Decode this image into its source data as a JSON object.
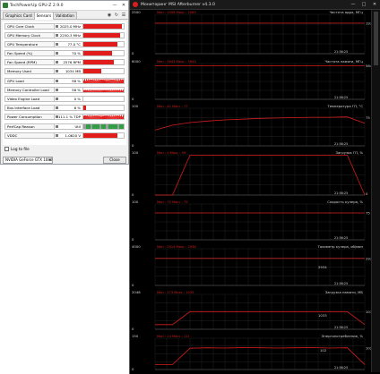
{
  "gpuz": {
    "title": "TechPowerUp GPU-Z 2.9.0",
    "tabs": [
      "Graphics Card",
      "Sensors",
      "Validation"
    ],
    "active_tab": 1,
    "sensors": [
      {
        "name": "GPU Core Clock",
        "value": "2025.0 MHz",
        "fill": 0.95,
        "kind": "bar"
      },
      {
        "name": "GPU Memory Clock",
        "value": "2250.3 MHz",
        "fill": 0.9,
        "kind": "bar"
      },
      {
        "name": "GPU Temperature",
        "value": "77.0 °C",
        "fill": 0.85,
        "kind": "bar"
      },
      {
        "name": "Fan Speed (%)",
        "value": "70 %",
        "fill": 0.7,
        "kind": "bar"
      },
      {
        "name": "Fan Speed (RPM)",
        "value": "2576 RPM",
        "fill": 0.75,
        "kind": "bar"
      },
      {
        "name": "Memory Used",
        "value": "1034 MB",
        "fill": 0.45,
        "kind": "bar"
      },
      {
        "name": "GPU Load",
        "value": "98 %",
        "fill": 0.95,
        "kind": "noisy"
      },
      {
        "name": "Memory Controller Load",
        "value": "56 %",
        "fill": 0.55,
        "kind": "noisy"
      },
      {
        "name": "Video Engine Load",
        "value": "0 %",
        "fill": 0.0,
        "kind": "bar"
      },
      {
        "name": "Bus Interface Load",
        "value": "6 %",
        "fill": 0.06,
        "kind": "bar"
      },
      {
        "name": "Power Consumption",
        "value": "111.1 % TDP",
        "fill": 0.9,
        "kind": "noisy"
      },
      {
        "name": "PerfCap Reason",
        "value": "Util",
        "fill": 1.0,
        "kind": "perfcap"
      },
      {
        "name": "VDDC",
        "value": "1.0620 V",
        "fill": 0.85,
        "kind": "bar"
      }
    ],
    "log_to_file_label": "Log to file",
    "log_to_file_checked": false,
    "gpu_select": "NVIDIA GeForce GTX 1080",
    "close_label": "Close",
    "colors": {
      "graph": "#e21b1b",
      "perfcap_green": "#2f9e44",
      "perfcap_gray": "#9e9e9e"
    }
  },
  "afterburner": {
    "title": "Мониторинг MSI Afterburner v4.3.0",
    "colors": {
      "line": "#d41c1c",
      "label": "#d8d8d8",
      "grid": "#2b2b2b",
      "axis": "#6a6a6a"
    },
    "panels": [
      {
        "id": "gpu-clock",
        "stats": "Мин : 1506  Макс : 2063",
        "label": "Частота ядра, МГц",
        "ymax": "2500",
        "ymin": "0",
        "current": "1936",
        "time": "21:56:25",
        "series": [
          1936,
          1936,
          1936,
          1936,
          1936,
          1936,
          1936,
          1936,
          1936,
          1936,
          1936,
          1936,
          1936
        ]
      },
      {
        "id": "mem-clock",
        "stats": "Мин : 5643  Макс : 5643",
        "label": "Частота памяти, МГц",
        "ymax": "6000",
        "ymin": "0",
        "current": "5643",
        "time": "21:56:25",
        "series": [
          5643,
          5643,
          5643,
          5643,
          5643,
          5643,
          5643,
          5643,
          5643,
          5643,
          5643,
          5643,
          5643
        ]
      },
      {
        "id": "gpu-temp",
        "stats": "Мин : 42  Макс : 77",
        "label": "Температура ГП, °С",
        "ymax": "100",
        "ymin": "0",
        "current": "75",
        "time": "21:56:25",
        "series": [
          42,
          55,
          62,
          66,
          69,
          71,
          73,
          74,
          75,
          76,
          76,
          77,
          60
        ]
      },
      {
        "id": "gpu-load",
        "stats": "Мин : 0  Макс : 99",
        "label": "Загрузка ГП, %",
        "ymax": "100",
        "ymin": "0",
        "current": "0",
        "time": "21:56:25",
        "series": [
          0,
          0,
          99,
          99,
          99,
          99,
          99,
          99,
          99,
          99,
          99,
          99,
          0
        ]
      },
      {
        "id": "fan-speed",
        "stats": "Мин : 75  Макс : 75",
        "label": "Скорость кулера, %",
        "ymax": "100",
        "ymin": "0",
        "current": "75",
        "time": "21:56:25",
        "series": [
          75,
          75,
          75,
          75,
          75,
          75,
          75,
          75,
          75,
          75,
          75,
          75,
          75
        ]
      },
      {
        "id": "fan-tach",
        "stats": "Мин : 2914  Макс : 2936",
        "label": "Тахометр кулера, об/мин",
        "ymax": "4000",
        "ymin": "0",
        "current": "2936",
        "time": "21:56:25",
        "series": [
          2934,
          2934,
          2934,
          2934,
          2934,
          2934,
          2934,
          2934,
          2934,
          2934,
          2934,
          2934,
          2934
        ]
      },
      {
        "id": "mem-load",
        "stats": "Мин : 273  Макс : 1035",
        "label": "Загрузка памяти, МБ",
        "ymax": "2048",
        "ymin": "0",
        "current": "1033",
        "time": "21:56:25",
        "series": [
          273,
          273,
          1033,
          1033,
          1033,
          1033,
          1033,
          1033,
          1033,
          1033,
          1033,
          1033,
          273
        ]
      },
      {
        "id": "power",
        "stats": "Мин : 24  Макс : 111",
        "label": "Энергопотребление, %",
        "ymax": "150",
        "ymin": "0",
        "current": "102",
        "time": "21:56:25",
        "series": [
          24,
          24,
          102,
          104,
          103,
          105,
          104,
          103,
          104,
          105,
          103,
          104,
          24
        ]
      }
    ],
    "extra_values": {
      "fan-tach-right": "2936",
      "fan-tach-mid": "2934",
      "mem-load-mid": "1033",
      "power-mid": "102"
    }
  }
}
